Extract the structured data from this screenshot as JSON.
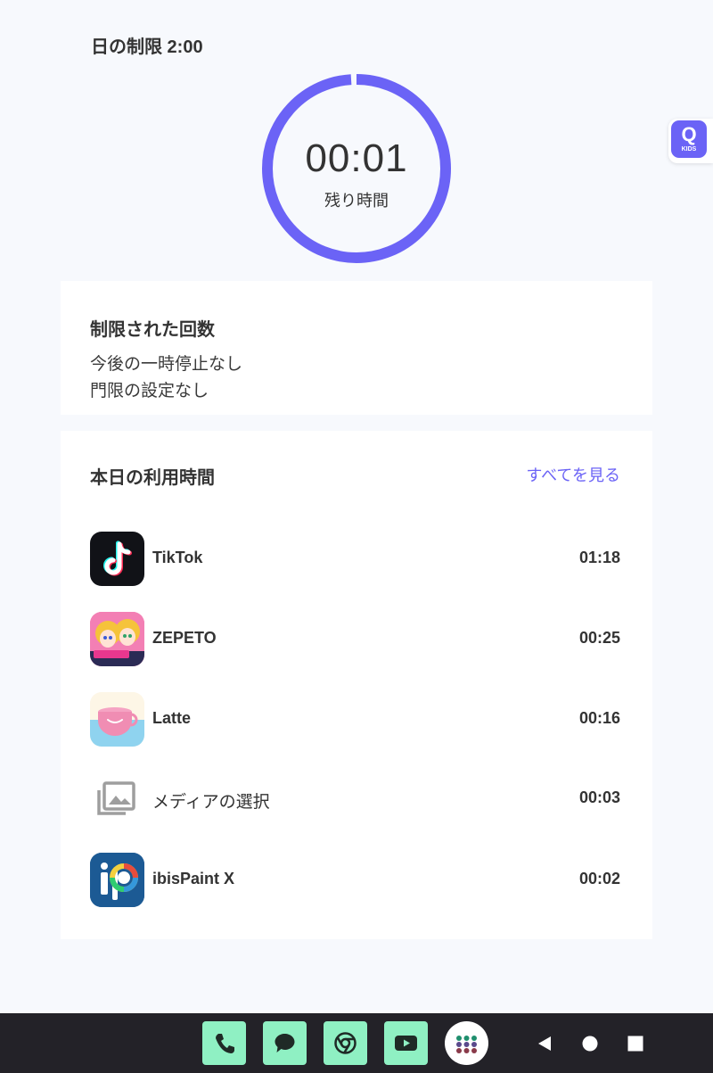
{
  "header": {
    "daily_limit": "日の制限 2:00"
  },
  "timer": {
    "remaining_time": "00:01",
    "remaining_label": "残り時間",
    "progress_remaining": 0.99,
    "ring_color": "#6b63f6"
  },
  "kids_badge": {
    "letter": "Q",
    "label": "KIDS"
  },
  "restrictions": {
    "title": "制限された回数",
    "pause_status": "今後の一時停止なし",
    "curfew_status": "門限の設定なし"
  },
  "usage": {
    "title": "本日の利用時間",
    "see_all": "すべてを見る",
    "apps": [
      {
        "name": "TikTok",
        "time": "01:18",
        "icon": "tiktok-icon"
      },
      {
        "name": "ZEPETO",
        "time": "00:25",
        "icon": "zepeto-icon"
      },
      {
        "name": "Latte",
        "time": "00:16",
        "icon": "latte-icon"
      },
      {
        "name": "メディアの選択",
        "time": "00:03",
        "icon": "media-picker-icon"
      },
      {
        "name": "ibisPaint X",
        "time": "00:02",
        "icon": "ibispaint-icon"
      }
    ]
  },
  "dock": {
    "items": [
      "phone-icon",
      "messages-icon",
      "chrome-icon",
      "youtube-icon",
      "app-drawer-icon"
    ],
    "accent": "#8ff0c3"
  },
  "nav": {
    "keys": [
      "back",
      "home",
      "recents"
    ]
  }
}
